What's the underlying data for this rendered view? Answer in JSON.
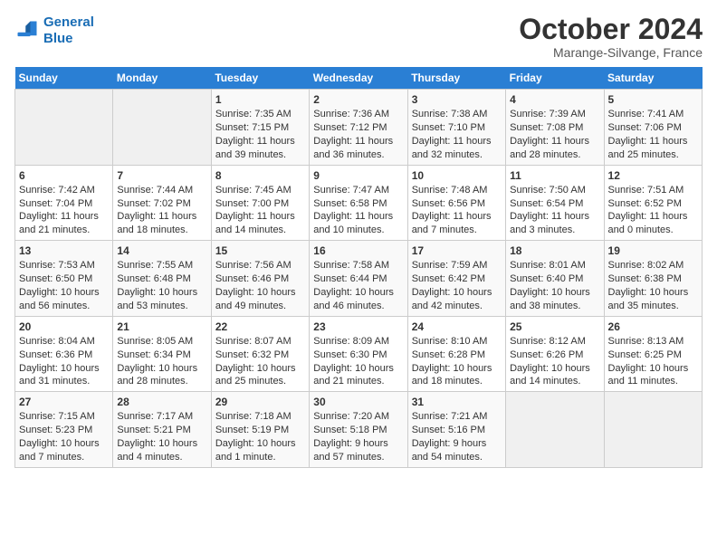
{
  "header": {
    "logo_line1": "General",
    "logo_line2": "Blue",
    "month": "October 2024",
    "location": "Marange-Silvange, France"
  },
  "days_of_week": [
    "Sunday",
    "Monday",
    "Tuesday",
    "Wednesday",
    "Thursday",
    "Friday",
    "Saturday"
  ],
  "weeks": [
    [
      {
        "day": "",
        "info": ""
      },
      {
        "day": "",
        "info": ""
      },
      {
        "day": "1",
        "info": "Sunrise: 7:35 AM\nSunset: 7:15 PM\nDaylight: 11 hours and 39 minutes."
      },
      {
        "day": "2",
        "info": "Sunrise: 7:36 AM\nSunset: 7:12 PM\nDaylight: 11 hours and 36 minutes."
      },
      {
        "day": "3",
        "info": "Sunrise: 7:38 AM\nSunset: 7:10 PM\nDaylight: 11 hours and 32 minutes."
      },
      {
        "day": "4",
        "info": "Sunrise: 7:39 AM\nSunset: 7:08 PM\nDaylight: 11 hours and 28 minutes."
      },
      {
        "day": "5",
        "info": "Sunrise: 7:41 AM\nSunset: 7:06 PM\nDaylight: 11 hours and 25 minutes."
      }
    ],
    [
      {
        "day": "6",
        "info": "Sunrise: 7:42 AM\nSunset: 7:04 PM\nDaylight: 11 hours and 21 minutes."
      },
      {
        "day": "7",
        "info": "Sunrise: 7:44 AM\nSunset: 7:02 PM\nDaylight: 11 hours and 18 minutes."
      },
      {
        "day": "8",
        "info": "Sunrise: 7:45 AM\nSunset: 7:00 PM\nDaylight: 11 hours and 14 minutes."
      },
      {
        "day": "9",
        "info": "Sunrise: 7:47 AM\nSunset: 6:58 PM\nDaylight: 11 hours and 10 minutes."
      },
      {
        "day": "10",
        "info": "Sunrise: 7:48 AM\nSunset: 6:56 PM\nDaylight: 11 hours and 7 minutes."
      },
      {
        "day": "11",
        "info": "Sunrise: 7:50 AM\nSunset: 6:54 PM\nDaylight: 11 hours and 3 minutes."
      },
      {
        "day": "12",
        "info": "Sunrise: 7:51 AM\nSunset: 6:52 PM\nDaylight: 11 hours and 0 minutes."
      }
    ],
    [
      {
        "day": "13",
        "info": "Sunrise: 7:53 AM\nSunset: 6:50 PM\nDaylight: 10 hours and 56 minutes."
      },
      {
        "day": "14",
        "info": "Sunrise: 7:55 AM\nSunset: 6:48 PM\nDaylight: 10 hours and 53 minutes."
      },
      {
        "day": "15",
        "info": "Sunrise: 7:56 AM\nSunset: 6:46 PM\nDaylight: 10 hours and 49 minutes."
      },
      {
        "day": "16",
        "info": "Sunrise: 7:58 AM\nSunset: 6:44 PM\nDaylight: 10 hours and 46 minutes."
      },
      {
        "day": "17",
        "info": "Sunrise: 7:59 AM\nSunset: 6:42 PM\nDaylight: 10 hours and 42 minutes."
      },
      {
        "day": "18",
        "info": "Sunrise: 8:01 AM\nSunset: 6:40 PM\nDaylight: 10 hours and 38 minutes."
      },
      {
        "day": "19",
        "info": "Sunrise: 8:02 AM\nSunset: 6:38 PM\nDaylight: 10 hours and 35 minutes."
      }
    ],
    [
      {
        "day": "20",
        "info": "Sunrise: 8:04 AM\nSunset: 6:36 PM\nDaylight: 10 hours and 31 minutes."
      },
      {
        "day": "21",
        "info": "Sunrise: 8:05 AM\nSunset: 6:34 PM\nDaylight: 10 hours and 28 minutes."
      },
      {
        "day": "22",
        "info": "Sunrise: 8:07 AM\nSunset: 6:32 PM\nDaylight: 10 hours and 25 minutes."
      },
      {
        "day": "23",
        "info": "Sunrise: 8:09 AM\nSunset: 6:30 PM\nDaylight: 10 hours and 21 minutes."
      },
      {
        "day": "24",
        "info": "Sunrise: 8:10 AM\nSunset: 6:28 PM\nDaylight: 10 hours and 18 minutes."
      },
      {
        "day": "25",
        "info": "Sunrise: 8:12 AM\nSunset: 6:26 PM\nDaylight: 10 hours and 14 minutes."
      },
      {
        "day": "26",
        "info": "Sunrise: 8:13 AM\nSunset: 6:25 PM\nDaylight: 10 hours and 11 minutes."
      }
    ],
    [
      {
        "day": "27",
        "info": "Sunrise: 7:15 AM\nSunset: 5:23 PM\nDaylight: 10 hours and 7 minutes."
      },
      {
        "day": "28",
        "info": "Sunrise: 7:17 AM\nSunset: 5:21 PM\nDaylight: 10 hours and 4 minutes."
      },
      {
        "day": "29",
        "info": "Sunrise: 7:18 AM\nSunset: 5:19 PM\nDaylight: 10 hours and 1 minute."
      },
      {
        "day": "30",
        "info": "Sunrise: 7:20 AM\nSunset: 5:18 PM\nDaylight: 9 hours and 57 minutes."
      },
      {
        "day": "31",
        "info": "Sunrise: 7:21 AM\nSunset: 5:16 PM\nDaylight: 9 hours and 54 minutes."
      },
      {
        "day": "",
        "info": ""
      },
      {
        "day": "",
        "info": ""
      }
    ]
  ]
}
